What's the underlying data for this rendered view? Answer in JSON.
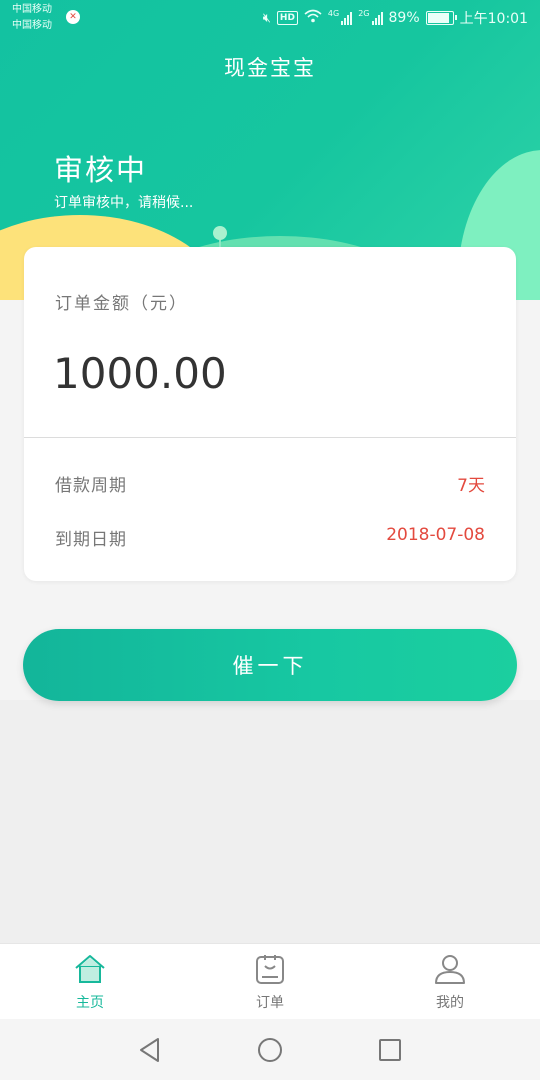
{
  "status_bar": {
    "carrier_1": "中国移动",
    "carrier_2": "中国移动",
    "hd": "HD",
    "net_1": "4G",
    "net_2": "2G",
    "battery": "89%",
    "time": "上午10:01"
  },
  "header": {
    "title": "现金宝宝",
    "status_heading": "审核中",
    "status_sub": "订单审核中，请稍候..."
  },
  "card": {
    "amount_label": "订单金额（元）",
    "amount_value": "1000.00",
    "rows": [
      {
        "label": "借款周期",
        "value": "7天"
      },
      {
        "label": "到期日期",
        "value": "2018-07-08"
      }
    ]
  },
  "urge_button": {
    "label": "催一下"
  },
  "tabs": [
    {
      "label": "主页",
      "icon": "home-icon",
      "active": true
    },
    {
      "label": "订单",
      "icon": "order-icon",
      "active": false
    },
    {
      "label": "我的",
      "icon": "profile-icon",
      "active": false
    }
  ],
  "colors": {
    "brand": "#16c3a0",
    "value_red": "#e34a3f",
    "active_tab": "#17b89b"
  },
  "nav": {
    "back_icon": "back-icon",
    "home_icon": "home-circle-icon",
    "recent_icon": "recent-apps-icon"
  }
}
